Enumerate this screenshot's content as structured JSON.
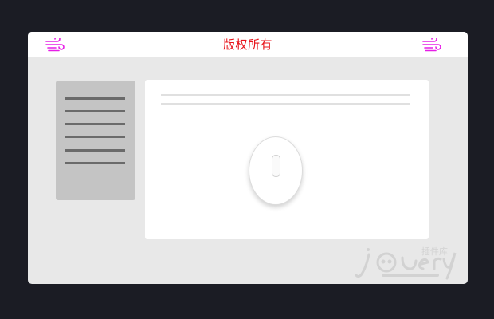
{
  "window": {
    "title": "版权所有",
    "title_color": "#e8141c",
    "icon_color": "#e61ee6",
    "left_icon": "wind-icon",
    "right_icon": "wind-icon"
  },
  "sidebar": {
    "line_count": 6
  },
  "content": {
    "icon": "mouse-icon"
  },
  "watermark": {
    "logo": "jquery-logo",
    "text": "插件库"
  }
}
